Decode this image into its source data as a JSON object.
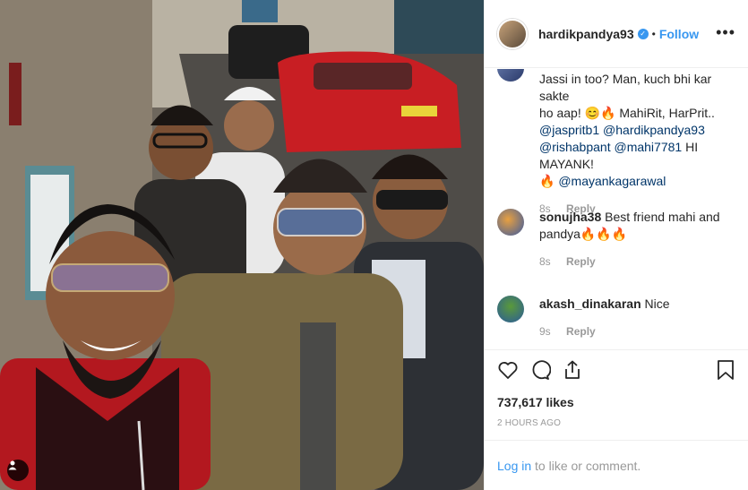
{
  "post": {
    "username": "hardikpandya93",
    "verified_mark": "✓",
    "separator": "•",
    "follow_label": "Follow",
    "more_icon": "more-icon"
  },
  "comments": [
    {
      "text_line1": "Jassi in too? Man, kuch bhi kar sakte",
      "text_line2": "ho aap! 😊🔥 MahiRit, HarPrit..",
      "mentions_line3a": "@jaspritb1",
      "mentions_line3b": "@hardikpandya93",
      "mentions_line4a": "@rishabpant",
      "mentions_line4b": "@mahi7781",
      "text_line4c": "HI MAYANK!",
      "text_line5a": "🔥",
      "mentions_line5b": "@mayankagarawal",
      "age": "8s",
      "reply": "Reply"
    },
    {
      "user": "sonujha38",
      "text": "Best friend mahi and",
      "text_line2": "pandya🔥🔥🔥",
      "age": "8s",
      "reply": "Reply"
    },
    {
      "user": "akash_dinakaran",
      "text": "Nice",
      "age": "9s",
      "reply": "Reply"
    }
  ],
  "actions": {
    "likes": "737,617 likes",
    "time": "2 HOURS AGO"
  },
  "login": {
    "link": "Log in",
    "rest": " to like or comment."
  },
  "colors": {
    "accent": "#3897f0",
    "mention": "#003569",
    "muted": "#999999",
    "border": "#efefef"
  }
}
